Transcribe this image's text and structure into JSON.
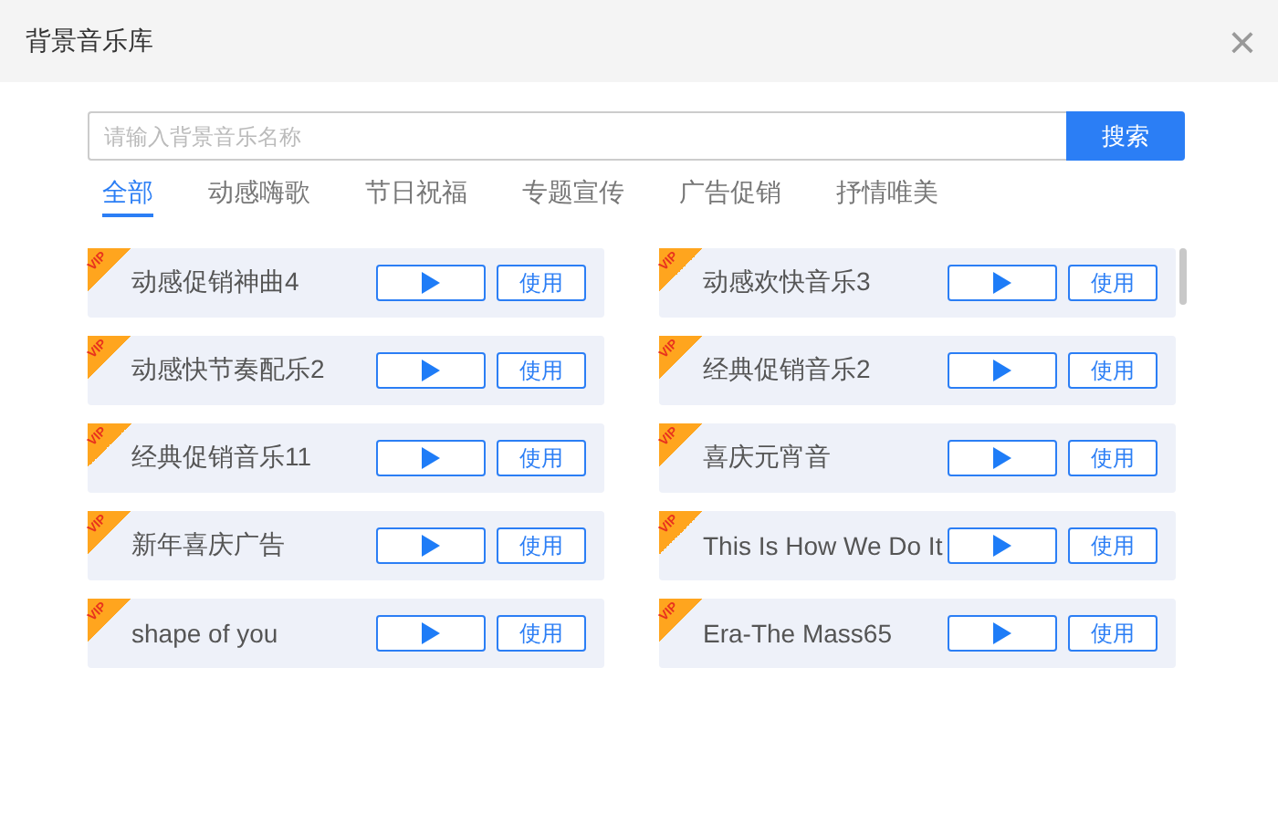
{
  "window": {
    "title": "背景音乐库",
    "close": "×"
  },
  "search": {
    "placeholder": "请输入背景音乐名称",
    "button": "搜索"
  },
  "tabs": [
    {
      "label": "全部",
      "selected": true
    },
    {
      "label": "动感嗨歌",
      "selected": false
    },
    {
      "label": "节日祝福",
      "selected": false
    },
    {
      "label": "专题宣传",
      "selected": false
    },
    {
      "label": "广告促销",
      "selected": false
    },
    {
      "label": "抒情唯美",
      "selected": false
    }
  ],
  "tracks": [
    {
      "title": "动感促销神曲4",
      "badge": "VIP",
      "use": "使用"
    },
    {
      "title": "动感欢快音乐3",
      "badge": "VIP",
      "use": "使用"
    },
    {
      "title": "动感快节奏配乐2",
      "badge": "VIP",
      "use": "使用"
    },
    {
      "title": "经典促销音乐2",
      "badge": "VIP",
      "use": "使用"
    },
    {
      "title": "经典促销音乐11",
      "badge": "VIP",
      "use": "使用"
    },
    {
      "title": "喜庆元宵音",
      "badge": "VIP",
      "use": "使用"
    },
    {
      "title": "新年喜庆广告",
      "badge": "VIP",
      "use": "使用"
    },
    {
      "title": "This Is How We Do It",
      "badge": "VIP",
      "use": "使用"
    },
    {
      "title": "shape of you",
      "badge": "VIP",
      "use": "使用"
    },
    {
      "title": "Era-The Mass65",
      "badge": "VIP",
      "use": "使用"
    }
  ]
}
